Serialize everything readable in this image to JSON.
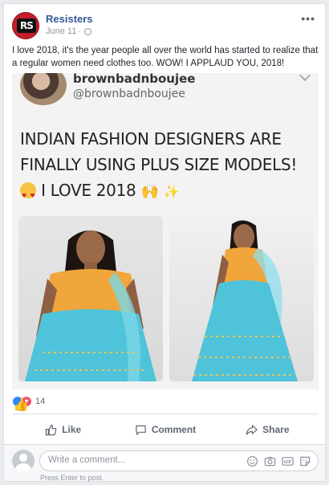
{
  "post": {
    "page_name": "Resisters",
    "avatar_text": "RS",
    "date": "June 11",
    "separator": " · ",
    "more": "•••",
    "text": "I love 2018, it's the year people all over the world has started to realize that a regular women need clothes too. WOW! I APPLAUD YOU, 2018!"
  },
  "shared_image": {
    "display_name": "brownbadnboujee",
    "handle": "@brownbadnboujee",
    "tweet_line1": "INDIAN FASHION DESIGNERS ARE",
    "tweet_line2": "FINALLY USING PLUS SIZE MODELS!",
    "tweet_line3": "I LOVE 2018",
    "emoji_names": [
      "heart-eyes-emoji",
      "raised-hands-emoji",
      "sparkles-emoji"
    ]
  },
  "reactions": {
    "types": [
      "like",
      "love"
    ],
    "count": "14"
  },
  "actions": {
    "like": "Like",
    "comment": "Comment",
    "share": "Share"
  },
  "comment_box": {
    "placeholder": "Write a comment...",
    "hint": "Press Enter to post.",
    "icons": [
      "emoji-icon",
      "camera-icon",
      "gif-icon",
      "sticker-icon"
    ]
  },
  "colors": {
    "link": "#365899",
    "like": "#2e89ff",
    "love": "#f25268",
    "muted": "#606770",
    "outfit_blouse": "#f0a63a",
    "outfit_skirt": "#4fc3d9"
  }
}
